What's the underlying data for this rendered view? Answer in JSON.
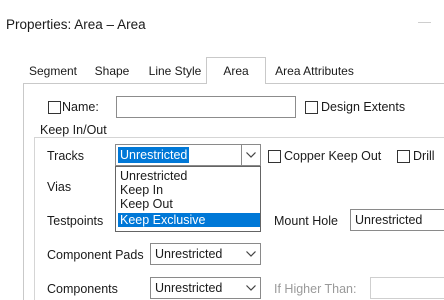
{
  "window": {
    "title": "Properties: Area – Area",
    "minimize_glyph": "—"
  },
  "tabs": [
    {
      "label": "Segment",
      "active": false
    },
    {
      "label": "Shape",
      "active": false
    },
    {
      "label": "Line Style",
      "active": false
    },
    {
      "label": "Area",
      "active": true
    },
    {
      "label": "Area Attributes",
      "active": false
    }
  ],
  "name_row": {
    "label": "Name:",
    "checked": false,
    "value": "",
    "design_extents_label": "Design Extents",
    "design_extents_checked": false
  },
  "keep_group": {
    "title": "Keep In/Out"
  },
  "tracks": {
    "label": "Tracks",
    "selected": "Unrestricted",
    "options": [
      "Unrestricted",
      "Keep In",
      "Keep Out",
      "Keep Exclusive"
    ],
    "highlighted": "Keep Exclusive"
  },
  "copper_keep_out": {
    "label": "Copper  Keep Out",
    "checked": false
  },
  "drill": {
    "label": "Drill",
    "checked": false
  },
  "vias": {
    "label": "Vias"
  },
  "testpoints": {
    "label": "Testpoints"
  },
  "mount_hole": {
    "label": "Mount Hole",
    "value": "Unrestricted"
  },
  "component_pads": {
    "label": "Component Pads",
    "value": "Unrestricted"
  },
  "components": {
    "label": "Components",
    "value": "Unrestricted"
  },
  "if_higher": {
    "label": "If Higher Than:",
    "value": ""
  },
  "icons": {
    "dropdown_arrow": "chevron-down-icon"
  }
}
